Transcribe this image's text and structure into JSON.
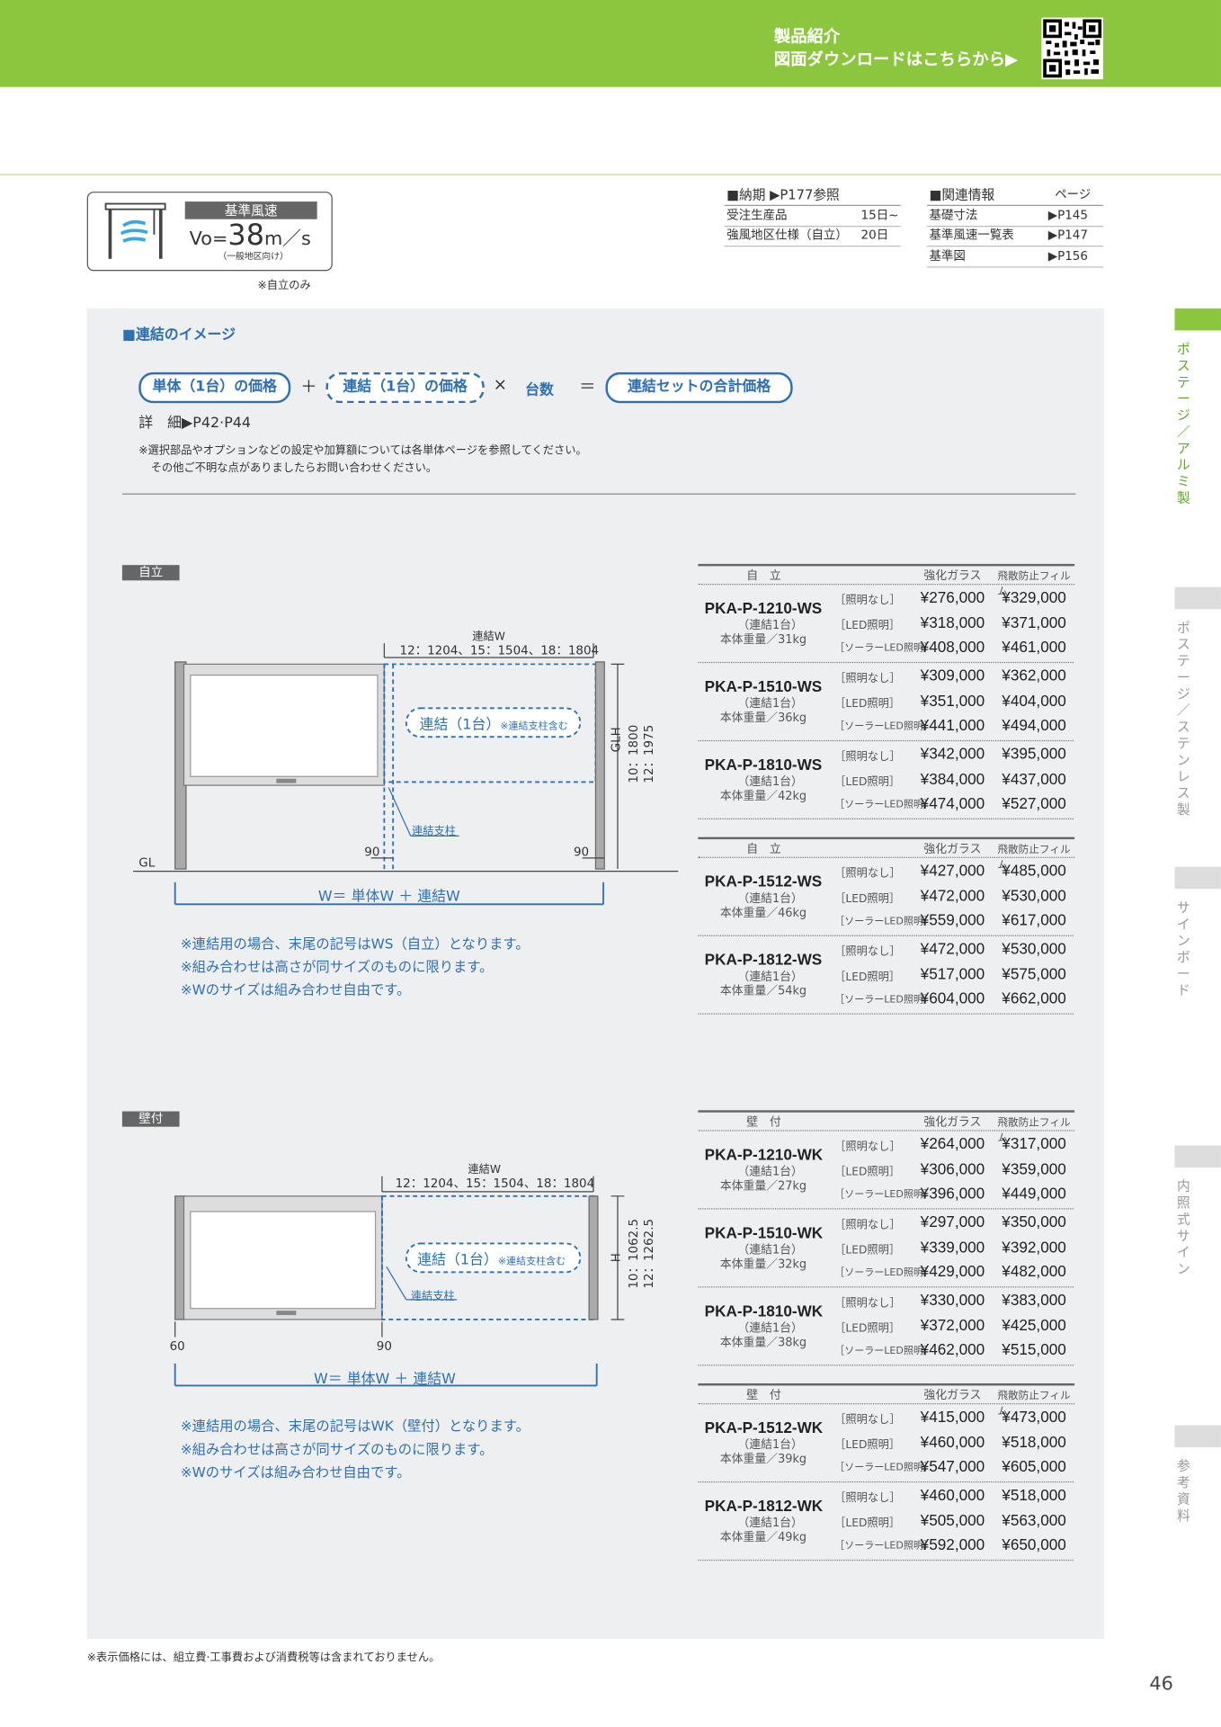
{
  "header": {
    "line1": "製品紹介",
    "line2": "図面ダウンロードはこちらから▶"
  },
  "wind": {
    "label": "基準風速",
    "vo_prefix": "Vo=",
    "vo_value": "38",
    "vo_unit": "m／s",
    "sub": "（一般地区向け）",
    "note": "※自立のみ"
  },
  "delivery": {
    "title": "■納期 ▶P177参照",
    "rows": [
      {
        "k": "受注生産品",
        "v": "15日~"
      },
      {
        "k": "強風地区仕様（自立）",
        "v": "20日"
      }
    ]
  },
  "related": {
    "title": "■関連情報",
    "page_label": "ページ",
    "rows": [
      {
        "k": "基礎寸法",
        "v": "▶P145"
      },
      {
        "k": "基準風速一覧表",
        "v": "▶P147"
      },
      {
        "k": "基準図",
        "v": "▶P156"
      }
    ]
  },
  "image_title": "■連結のイメージ",
  "formula": {
    "a": "単体（1台）の価格",
    "plus": "＋",
    "b": "連結（1台）の価格",
    "times": "×",
    "c": "台数",
    "eq": "＝",
    "d": "連結セットの合計価格"
  },
  "detail": "詳　細▶P42·P44",
  "notes": [
    "※選択部品やオプションなどの設定や加算額については各単体ページを参照してください。",
    "その他ご不明な点がありましたらお問い合わせください。"
  ],
  "jiritsu": {
    "tag": "自立",
    "dim_title": "連結W",
    "dim_values": "12：1204、15：1504、18：1804",
    "bubble": "連結（1台）",
    "bubble_small": "※連結支柱含む",
    "post": "連結支柱",
    "glh": "GLH",
    "h1": "10：1800",
    "h2": "12：1975",
    "gl": "GL",
    "d90a": "90",
    "d90b": "90",
    "w_formula": "W＝ 単体W ＋ 連結W",
    "notes": [
      "※連結用の場合、末尾の記号はWS（自立）となります。",
      "※組み合わせは高さが同サイズのものに限ります。",
      "※Wのサイズは組み合わせ自由です。"
    ]
  },
  "kabetsuke": {
    "tag": "壁付",
    "dim_title": "連結W",
    "dim_values": "12：1204、15：1504、18：1804",
    "bubble": "連結（1台）",
    "bubble_small": "※連結支柱含む",
    "post": "連結支柱",
    "h": "H",
    "h1": "10：1062.5",
    "h2": "12：1262.5",
    "d60": "60",
    "d90": "90",
    "w_formula": "W＝ 単体W ＋ 連結W",
    "notes": [
      "※連結用の場合、末尾の記号はWK（壁付）となります。",
      "※組み合わせは高さが同サイズのものに限ります。",
      "※Wのサイズは組み合わせ自由です。"
    ]
  },
  "table_head": {
    "glass": "強化ガラス",
    "film": "飛散防止フィルム"
  },
  "light_labels": [
    "［照明なし］",
    "［LED照明］",
    "［ソーラーLED照明］"
  ],
  "tables": [
    {
      "title": "自　立",
      "models": [
        {
          "name": "PKA-P-1210-WS",
          "sub": "（連結1台）",
          "weight": "本体重量／31kg",
          "prices": [
            [
              "¥276,000",
              "¥329,000"
            ],
            [
              "¥318,000",
              "¥371,000"
            ],
            [
              "¥408,000",
              "¥461,000"
            ]
          ]
        },
        {
          "name": "PKA-P-1510-WS",
          "sub": "（連結1台）",
          "weight": "本体重量／36kg",
          "prices": [
            [
              "¥309,000",
              "¥362,000"
            ],
            [
              "¥351,000",
              "¥404,000"
            ],
            [
              "¥441,000",
              "¥494,000"
            ]
          ]
        },
        {
          "name": "PKA-P-1810-WS",
          "sub": "（連結1台）",
          "weight": "本体重量／42kg",
          "prices": [
            [
              "¥342,000",
              "¥395,000"
            ],
            [
              "¥384,000",
              "¥437,000"
            ],
            [
              "¥474,000",
              "¥527,000"
            ]
          ]
        }
      ]
    },
    {
      "title": "自　立",
      "models": [
        {
          "name": "PKA-P-1512-WS",
          "sub": "（連結1台）",
          "weight": "本体重量／46kg",
          "prices": [
            [
              "¥427,000",
              "¥485,000"
            ],
            [
              "¥472,000",
              "¥530,000"
            ],
            [
              "¥559,000",
              "¥617,000"
            ]
          ]
        },
        {
          "name": "PKA-P-1812-WS",
          "sub": "（連結1台）",
          "weight": "本体重量／54kg",
          "prices": [
            [
              "¥472,000",
              "¥530,000"
            ],
            [
              "¥517,000",
              "¥575,000"
            ],
            [
              "¥604,000",
              "¥662,000"
            ]
          ]
        }
      ]
    },
    {
      "title": "壁　付",
      "models": [
        {
          "name": "PKA-P-1210-WK",
          "sub": "（連結1台）",
          "weight": "本体重量／27kg",
          "prices": [
            [
              "¥264,000",
              "¥317,000"
            ],
            [
              "¥306,000",
              "¥359,000"
            ],
            [
              "¥396,000",
              "¥449,000"
            ]
          ]
        },
        {
          "name": "PKA-P-1510-WK",
          "sub": "（連結1台）",
          "weight": "本体重量／32kg",
          "prices": [
            [
              "¥297,000",
              "¥350,000"
            ],
            [
              "¥339,000",
              "¥392,000"
            ],
            [
              "¥429,000",
              "¥482,000"
            ]
          ]
        },
        {
          "name": "PKA-P-1810-WK",
          "sub": "（連結1台）",
          "weight": "本体重量／38kg",
          "prices": [
            [
              "¥330,000",
              "¥383,000"
            ],
            [
              "¥372,000",
              "¥425,000"
            ],
            [
              "¥462,000",
              "¥515,000"
            ]
          ]
        }
      ]
    },
    {
      "title": "壁　付",
      "models": [
        {
          "name": "PKA-P-1512-WK",
          "sub": "（連結1台）",
          "weight": "本体重量／39kg",
          "prices": [
            [
              "¥415,000",
              "¥473,000"
            ],
            [
              "¥460,000",
              "¥518,000"
            ],
            [
              "¥547,000",
              "¥605,000"
            ]
          ]
        },
        {
          "name": "PKA-P-1812-WK",
          "sub": "（連結1台）",
          "weight": "本体重量／49kg",
          "prices": [
            [
              "¥460,000",
              "¥518,000"
            ],
            [
              "¥505,000",
              "¥563,000"
            ],
            [
              "¥592,000",
              "¥650,000"
            ]
          ]
        }
      ]
    }
  ],
  "side_tabs": [
    "ポステージ／アルミ製",
    "ポステージ／ステンレス製",
    "サインボード",
    "内照式サイン",
    "参考資料"
  ],
  "footnote": "※表示価格には、組立費·工事費および消費税等は含まれておりません。",
  "page_number": "46",
  "colors": {
    "green": "#8cc63f",
    "blue": "#2f70b5",
    "gray_bg": "#eeeff0"
  }
}
